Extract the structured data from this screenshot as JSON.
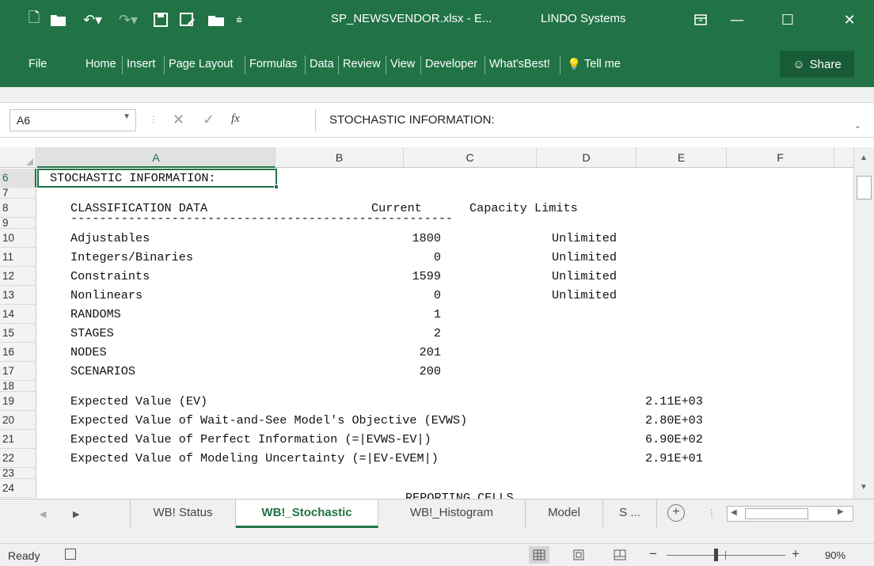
{
  "window": {
    "doc_title": "SP_NEWSVENDOR.xlsx - E...",
    "company": "LINDO Systems",
    "minimize": "—",
    "maximize": "☐",
    "close": "✕"
  },
  "qat": {
    "icons": [
      "new-icon",
      "open-icon",
      "undo-icon",
      "redo-icon",
      "save-icon",
      "save-as-icon",
      "folder-icon",
      "customize-icon"
    ]
  },
  "ribbon": {
    "tabs": [
      "File",
      "Home",
      "Insert",
      "Page Layout",
      "Formulas",
      "Data",
      "Review",
      "View",
      "Developer",
      "What'sBest!",
      "Tell me"
    ],
    "share": "Share"
  },
  "formula_bar": {
    "name_box": "A6",
    "fx": "fx",
    "formula": "STOCHASTIC INFORMATION:"
  },
  "columns": [
    "A",
    "B",
    "C",
    "D",
    "E",
    "F"
  ],
  "rows": [
    "6",
    "7",
    "8",
    "9",
    "10",
    "11",
    "12",
    "13",
    "14",
    "15",
    "16",
    "17",
    "18",
    "19",
    "20",
    "21",
    "22",
    "23",
    "24"
  ],
  "cells": {
    "a6": "STOCHASTIC INFORMATION:",
    "header_label": "CLASSIFICATION DATA",
    "header_current": "Current",
    "header_capacity": "Capacity Limits",
    "divider": "-----------------------------------------------------",
    "classification": [
      {
        "label": "Adjustables",
        "current": "1800",
        "limit": "Unlimited"
      },
      {
        "label": "Integers/Binaries",
        "current": "0",
        "limit": "Unlimited"
      },
      {
        "label": "Constraints",
        "current": "1599",
        "limit": "Unlimited"
      },
      {
        "label": "Nonlinears",
        "current": "0",
        "limit": "Unlimited"
      },
      {
        "label": "RANDOMS",
        "current": "1",
        "limit": ""
      },
      {
        "label": "STAGES",
        "current": "2",
        "limit": ""
      },
      {
        "label": "NODES",
        "current": "201",
        "limit": ""
      },
      {
        "label": "SCENARIOS",
        "current": "200",
        "limit": ""
      }
    ],
    "expected": [
      {
        "label": "Expected Value (EV)",
        "value": "2.11E+03"
      },
      {
        "label": "Expected Value of Wait-and-See Model's Objective (EVWS)",
        "value": "2.80E+03"
      },
      {
        "label": "Expected Value of Perfect Information (=|EVWS-EV|)",
        "value": "6.90E+02"
      },
      {
        "label": "Expected Value of Modeling Uncertainty (=|EV-EVEM|)",
        "value": "2.91E+01"
      }
    ],
    "reporting": "REPORTING CELLS"
  },
  "sheets": {
    "tabs": [
      "WB! Status",
      "WB!_Stochastic",
      "WB!_Histogram",
      "Model",
      "S ..."
    ],
    "active": "WB!_Stochastic"
  },
  "status": {
    "ready": "Ready",
    "zoom": "90%"
  }
}
